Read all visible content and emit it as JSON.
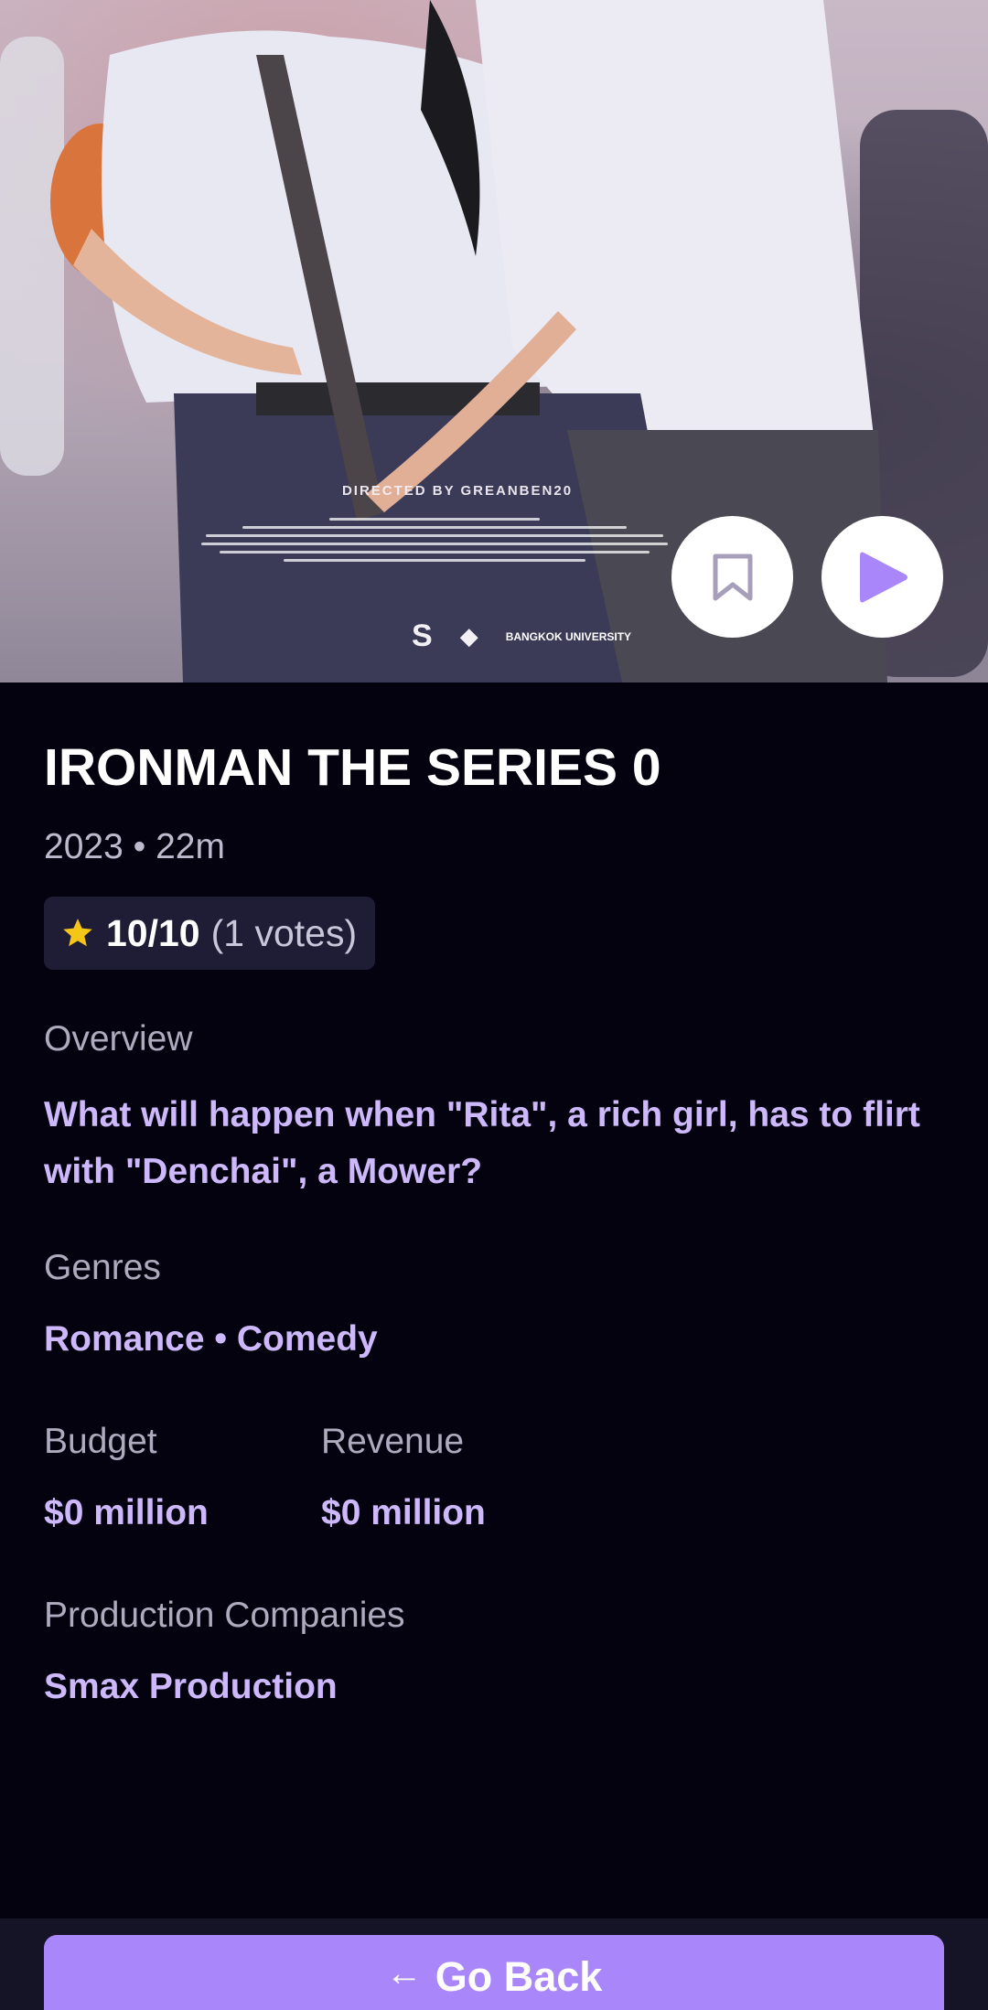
{
  "hero": {
    "poster_credit_title": "DIRECTED BY GREANBEN20",
    "logo_mark": "S",
    "logo_university": "BANGKOK UNIVERSITY",
    "bookmark_icon": "bookmark-icon",
    "play_icon": "play-icon"
  },
  "movie": {
    "title": "IRONMAN THE SERIES 0",
    "meta": "2023 • 22m",
    "rating_score": "10/10",
    "rating_votes": "(1 votes)",
    "overview_label": "Overview",
    "overview_text": "What will happen when \"Rita\", a rich girl, has to flirt with \"Denchai\", a Mower?",
    "genres_label": "Genres",
    "genres_value": "Romance • Comedy",
    "budget_label": "Budget",
    "budget_value": "$0 million",
    "revenue_label": "Revenue",
    "revenue_value": "$0 million",
    "companies_label": "Production Companies",
    "companies_value": "Smax Production"
  },
  "footer": {
    "go_back_label": "Go Back"
  },
  "colors": {
    "accent": "#a987fa",
    "accent_text": "#cdb8fb",
    "background": "#05020f",
    "star": "#f5c518"
  }
}
